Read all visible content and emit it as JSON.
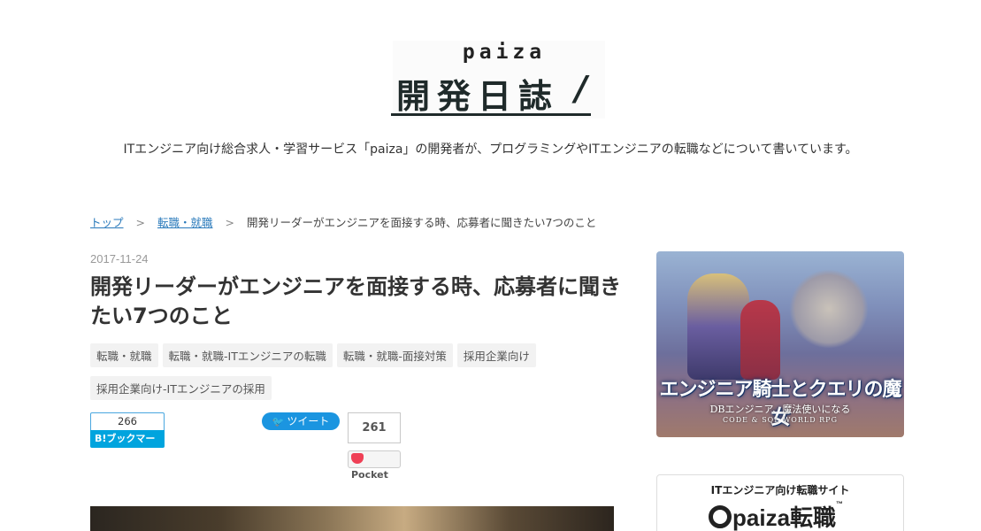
{
  "header": {
    "logo_top": "paiza",
    "logo_title": "開発日誌",
    "logo_slash": "/",
    "tagline": "ITエンジニア向け総合求人・学習サービス「paiza」の開発者が、プログラミングやITエンジニアの転職などについて書いています。"
  },
  "breadcrumb": {
    "items": [
      "トップ",
      "転職・就職"
    ],
    "separator": ">",
    "current": "開発リーダーがエンジニアを面接する時、応募者に聞きたい7つのこと"
  },
  "article": {
    "date": "2017-11-24",
    "title": "開発リーダーがエンジニアを面接する時、応募者に聞きたい7つのこと",
    "tags": [
      "転職・就職",
      "転職・就職-ITエンジニアの転職",
      "転職・就職-面接対策",
      "採用企業向け",
      "採用企業向け-ITエンジニアの採用"
    ]
  },
  "social": {
    "hatena_count": "266",
    "hatena_label": "B!ブックマーク",
    "tweet_label": "ツイート",
    "pocket_count": "261",
    "pocket_label": "Pocket"
  },
  "sidebar": {
    "banner_title": "エンジニア騎士とクエリの魔女",
    "banner_sub": "DBエンジニア、魔法使いになる",
    "banner_sub2": "CODE & SQL WORLD RPG",
    "jobbox_label": "ITエンジニア向け転職サイト",
    "jobbox_logo": "paiza転職",
    "jobbox_tm": "™"
  },
  "colors": {
    "link": "#2a7abb",
    "hatena": "#00a4de",
    "twitter": "#1b95e0",
    "pocket": "#ef4056"
  }
}
